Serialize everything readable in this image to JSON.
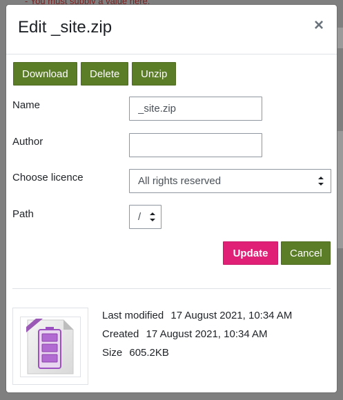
{
  "background": {
    "error_text": "- You must supply a value here."
  },
  "dialog": {
    "title": "Edit _site.zip",
    "close_symbol": "×",
    "actions": {
      "download": "Download",
      "delete": "Delete",
      "unzip": "Unzip"
    },
    "form": {
      "name_label": "Name",
      "name_value": "_site.zip",
      "author_label": "Author",
      "author_value": "",
      "licence_label": "Choose licence",
      "licence_value": "All rights reserved",
      "path_label": "Path",
      "path_value": "/"
    },
    "buttons": {
      "update": "Update",
      "cancel": "Cancel"
    },
    "file_info": {
      "last_modified_label": "Last modified",
      "last_modified_value": "17 August 2021, 10:34 AM",
      "created_label": "Created",
      "created_value": "17 August 2021, 10:34 AM",
      "size_label": "Size",
      "size_value": "605.2KB",
      "icon": "archive-file-icon"
    }
  },
  "colors": {
    "primary_green": "#5b7d27",
    "accent_pink": "#e01f77"
  }
}
